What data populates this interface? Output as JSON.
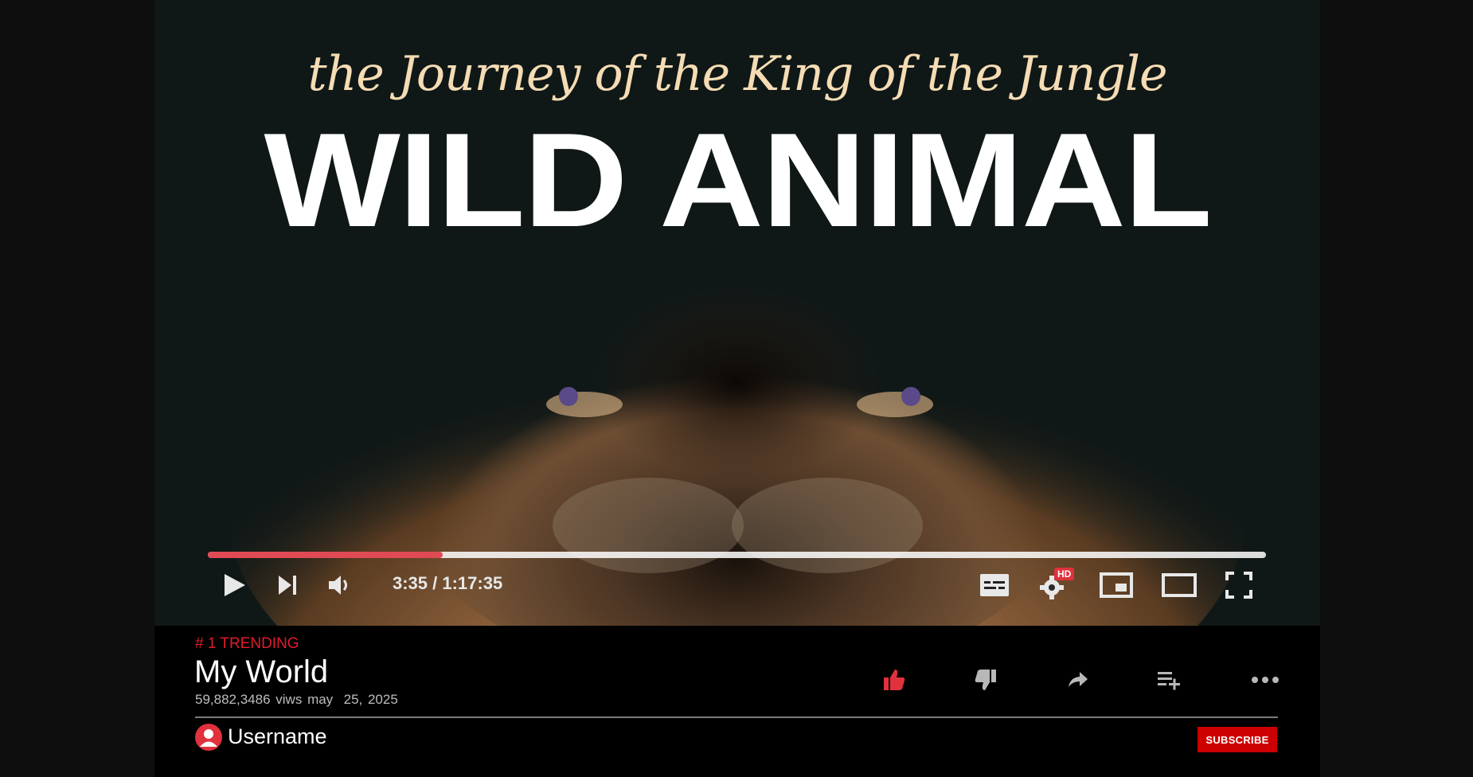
{
  "video": {
    "thumbnail_script_title": "the Journey of the King of the Jungle",
    "thumbnail_title": "WILD ANIMAL",
    "progress_fraction": 0.222,
    "time_display": "3:35 / 1:17:35",
    "hd_badge": "HD",
    "controls": {
      "play": "play-icon",
      "next": "skip-next-icon",
      "volume": "volume-icon",
      "captions": "captions-icon",
      "settings": "settings-icon",
      "miniplayer": "miniplayer-icon",
      "theater": "theater-mode-icon",
      "fullscreen": "fullscreen-icon"
    }
  },
  "info": {
    "trending": "# 1 TRENDING",
    "title": "My World",
    "views": "59,882,3486 viws",
    "date": "may  25, 2025",
    "actions": [
      "like-icon",
      "dislike-icon",
      "share-icon",
      "add-to-playlist-icon",
      "more-icon"
    ],
    "accent_color": "#e0313d"
  },
  "channel": {
    "username": "Username",
    "subscribe_label": "SUBSCRIBE"
  }
}
